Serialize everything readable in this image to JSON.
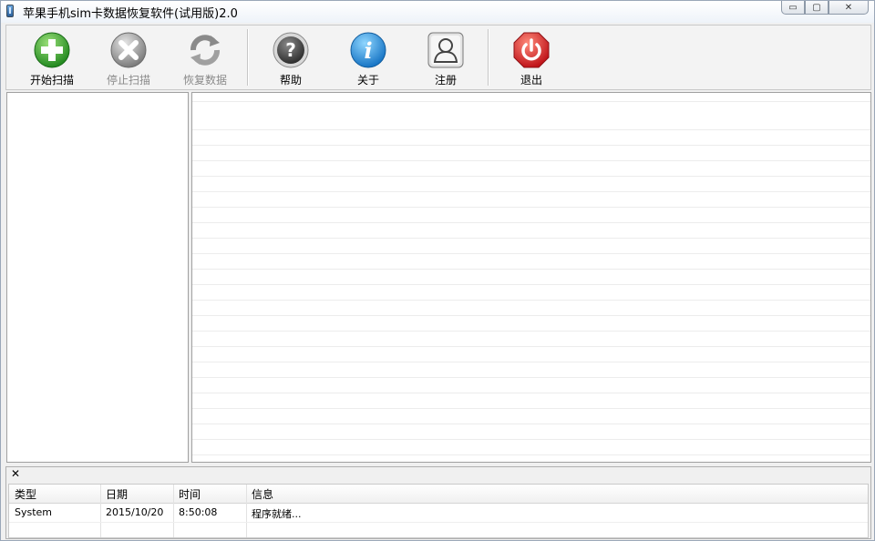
{
  "window": {
    "title": "苹果手机sim卡数据恢复软件(试用版)2.0",
    "controls": {
      "minimize": "▭",
      "maximize": "▢",
      "close": "✕"
    }
  },
  "toolbar": {
    "buttons": [
      {
        "id": "start-scan",
        "label": "开始扫描",
        "icon": "plus-circle-icon",
        "enabled": true,
        "color": "#2f9e2f"
      },
      {
        "id": "stop-scan",
        "label": "停止扫描",
        "icon": "x-circle-icon",
        "enabled": false,
        "color": "#8c8c8c"
      },
      {
        "id": "recover-data",
        "label": "恢复数据",
        "icon": "refresh-icon",
        "enabled": false,
        "color": "#8c8c8c"
      },
      {
        "id": "help",
        "label": "帮助",
        "icon": "question-icon",
        "enabled": true,
        "color": "#4a4a4a"
      },
      {
        "id": "about",
        "label": "关于",
        "icon": "info-icon",
        "enabled": true,
        "color": "#1f8fd8"
      },
      {
        "id": "register",
        "label": "注册",
        "icon": "user-icon",
        "enabled": true,
        "color": "#6a6a6a"
      },
      {
        "id": "exit",
        "label": "退出",
        "icon": "power-icon",
        "enabled": true,
        "color": "#d42a2a"
      }
    ]
  },
  "log": {
    "close_symbol": "✕",
    "columns": [
      "类型",
      "日期",
      "时间",
      "信息"
    ],
    "rows": [
      {
        "type": "System",
        "date": "2015/10/20",
        "time": "8:50:08",
        "info": "程序就绪..."
      }
    ]
  }
}
